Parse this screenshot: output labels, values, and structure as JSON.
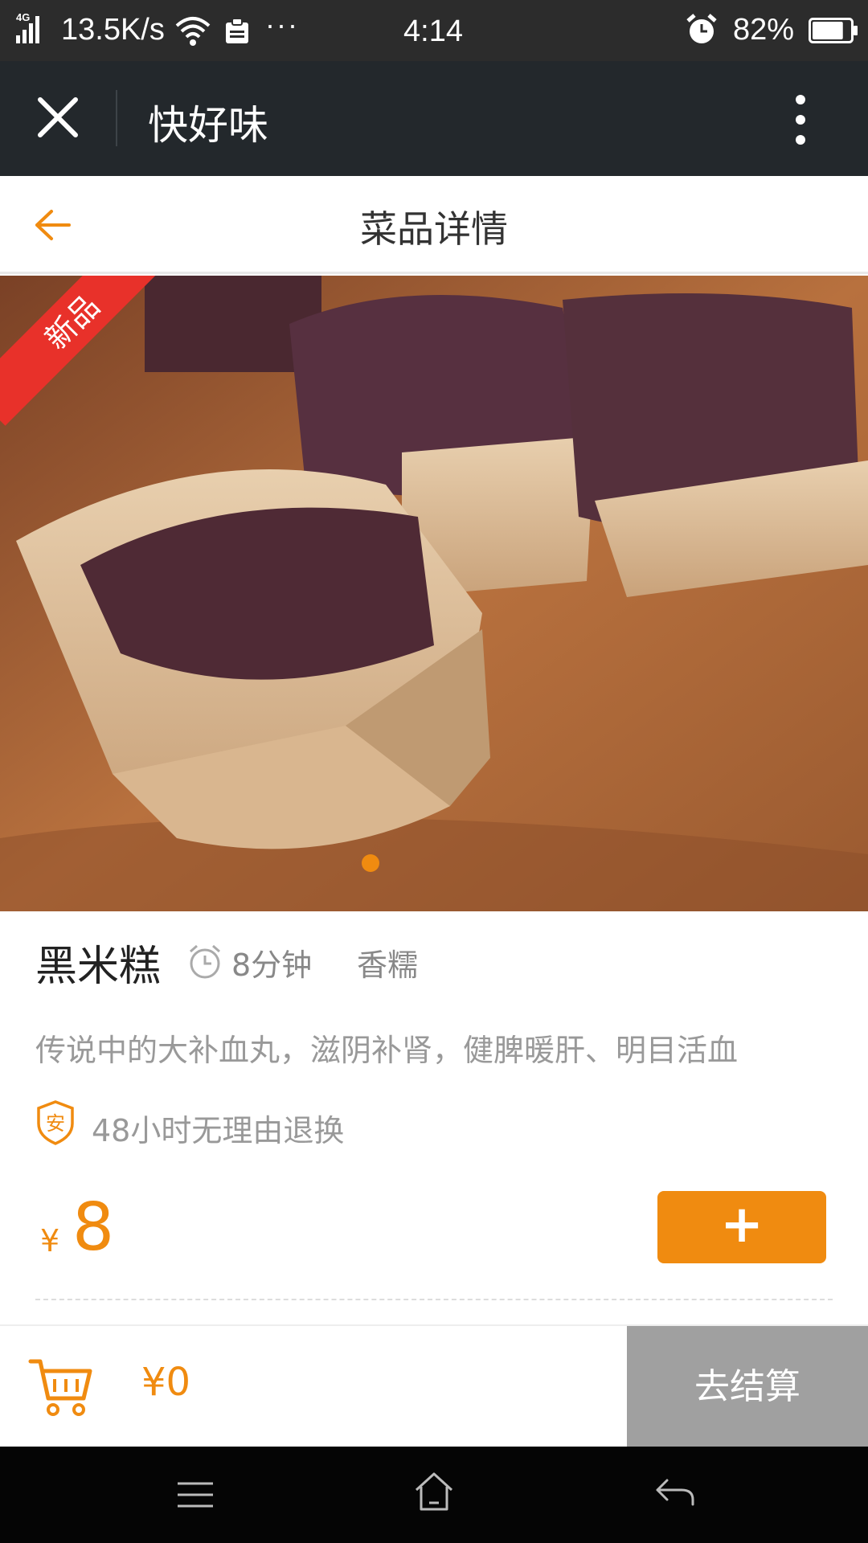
{
  "status_bar": {
    "network_type": "4G",
    "speed": "13.5K/s",
    "more_glyph": "···",
    "time": "4:14",
    "battery_percent": "82%",
    "battery_level": 0.82
  },
  "title_bar": {
    "title": "快好味",
    "close_icon": "close-icon",
    "more_icon": "more-vertical-icon"
  },
  "nav_bar": {
    "title": "菜品详情",
    "back_icon": "back-arrow-icon"
  },
  "hero": {
    "badge": "新品",
    "slide_index": 1,
    "slide_count": 1
  },
  "dish": {
    "name": "黑米糕",
    "cook_time": "8分钟",
    "flavor": "香糯",
    "description": "传说中的大补血丸，滋阴补肾，健脾暖肝、明目活血",
    "guarantee_badge": "安",
    "guarantee": "48小时无理由退换",
    "currency": "¥",
    "price": "8",
    "add_label": "+"
  },
  "cart": {
    "total": "¥0",
    "checkout_label": "去结算"
  },
  "colors": {
    "accent": "#f08b10",
    "ribbon": "#e8312a",
    "title_bar_bg": "#23282c",
    "checkout_disabled": "#a0a0a0"
  }
}
